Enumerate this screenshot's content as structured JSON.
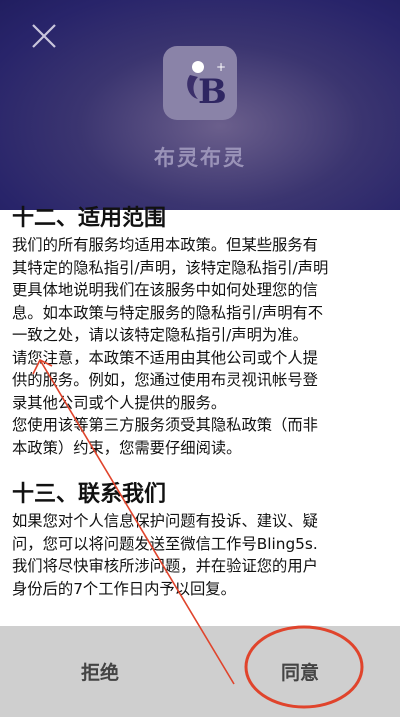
{
  "header": {
    "app_name": "布灵布灵",
    "close_icon": "close-icon",
    "logo_icon": "bling-logo-icon"
  },
  "section12": {
    "title": "十二、适用范围",
    "lines": [
      "我们的所有服务均适用本政策。但某些服务有",
      "其特定的隐私指引/声明，该特定隐私指引/声明",
      "更具体地说明我们在该服务中如何处理您的信",
      "息。如本政策与特定服务的隐私指引/声明有不",
      "一致之处，请以该特定隐私指引/声明为准。",
      "请您注意，本政策不适用由其他公司或个人提",
      "供的服务。例如，您通过使用布灵视讯帐号登",
      "录其他公司或个人提供的服务。",
      "您使用该等第三方服务须受其隐私政策（而非",
      "本政策）约束，您需要仔细阅读。"
    ]
  },
  "section13": {
    "title": "十三、联系我们",
    "lines": [
      "如果您对个人信息保护问题有投诉、建议、疑",
      "问，您可以将问题发送至微信工作号Bling5s.",
      "我们将尽快审核所涉问题，并在验证您的用户",
      "身份后的7个工作日内予以回复。"
    ]
  },
  "footer": {
    "reject_label": "拒绝",
    "agree_label": "同意"
  },
  "colors": {
    "header_bg": "#28246a",
    "annotation": "#e0442c",
    "footer_bg": "#cfcfcf"
  }
}
